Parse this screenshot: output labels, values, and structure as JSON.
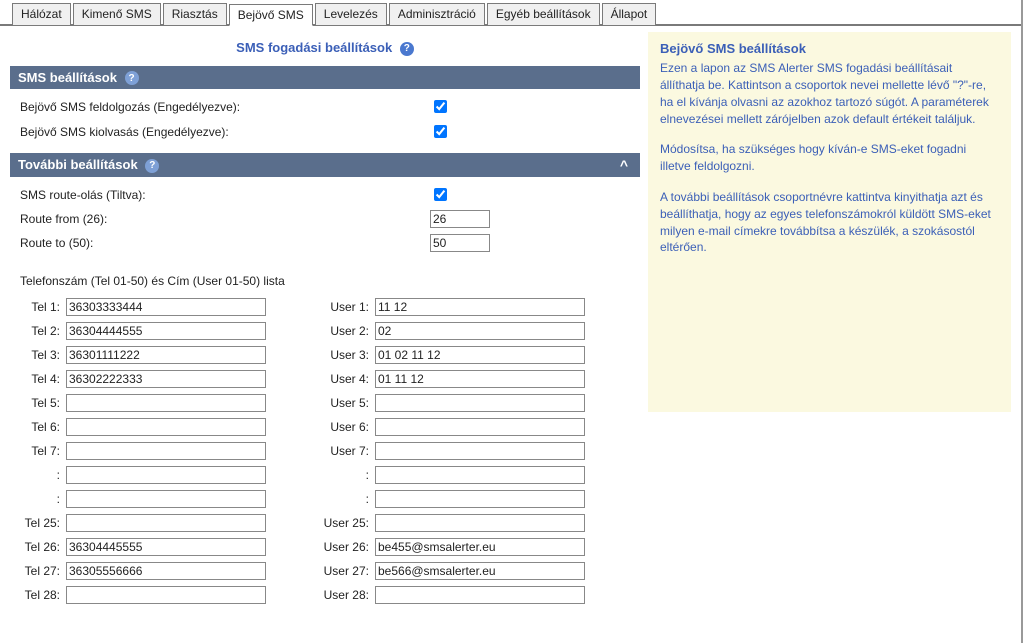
{
  "tabs": [
    {
      "label": "Hálózat"
    },
    {
      "label": "Kimenő SMS"
    },
    {
      "label": "Riasztás"
    },
    {
      "label": "Bejövő SMS",
      "active": true
    },
    {
      "label": "Levelezés"
    },
    {
      "label": "Adminisztráció"
    },
    {
      "label": "Egyéb beállítások"
    },
    {
      "label": "Állapot"
    }
  ],
  "page_title": "SMS fogadási beállítások",
  "section1": {
    "title": "SMS beállítások",
    "row1_label": "Bejövő SMS feldolgozás (Engedélyezve):",
    "row1_checked": true,
    "row2_label": "Bejövő SMS kiolvasás (Engedélyezve):",
    "row2_checked": true
  },
  "section2": {
    "title": "További beállítások",
    "toggle": "^",
    "row1_label": "SMS route-olás (Tiltva):",
    "row1_checked": true,
    "row2_label": "Route from (26):",
    "row2_value": "26",
    "row3_label": "Route to (50):",
    "row3_value": "50"
  },
  "tel_header": "Telefonszám (Tel 01-50) és Cím (User 01-50) lista",
  "rows": [
    {
      "tl": "Tel 1:",
      "tv": "36303333444",
      "ul": "User 1:",
      "uv": "11 12"
    },
    {
      "tl": "Tel 2:",
      "tv": "36304444555",
      "ul": "User 2:",
      "uv": "02"
    },
    {
      "tl": "Tel 3:",
      "tv": "36301111222",
      "ul": "User 3:",
      "uv": "01 02 11 12"
    },
    {
      "tl": "Tel 4:",
      "tv": "36302222333",
      "ul": "User 4:",
      "uv": "01 11 12"
    },
    {
      "tl": "Tel 5:",
      "tv": "",
      "ul": "User 5:",
      "uv": ""
    },
    {
      "tl": "Tel 6:",
      "tv": "",
      "ul": "User 6:",
      "uv": ""
    },
    {
      "tl": "Tel 7:",
      "tv": "",
      "ul": "User 7:",
      "uv": ""
    },
    {
      "tl": ":",
      "tv": "",
      "ul": ":",
      "uv": ""
    },
    {
      "tl": ":",
      "tv": "",
      "ul": ":",
      "uv": ""
    },
    {
      "tl": "Tel 25:",
      "tv": "",
      "ul": "User 25:",
      "uv": ""
    },
    {
      "tl": "Tel 26:",
      "tv": "36304445555",
      "ul": "User 26:",
      "uv": "be455@smsalerter.eu"
    },
    {
      "tl": "Tel 27:",
      "tv": "36305556666",
      "ul": "User 27:",
      "uv": "be566@smsalerter.eu"
    },
    {
      "tl": "Tel 28:",
      "tv": "",
      "ul": "User 28:",
      "uv": ""
    }
  ],
  "info": {
    "title": "Bejövő SMS beállítások",
    "p1": "Ezen a lapon az SMS Alerter SMS fogadási beállításait állíthatja be. Kattintson a csoportok nevei mellette lévő \"?\"-re, ha el kívánja olvasni az azokhoz tartozó súgót. A paraméterek elnevezései mellett zárójelben azok default értékeit találjuk.",
    "p2": "Módosítsa, ha szükséges hogy kíván-e SMS-eket fogadni illetve feldolgozni.",
    "p3": "A további beállítások csoportnévre kattintva kinyithatja azt és beállíthatja, hogy az egyes telefonszámokról küldött SMS-eket milyen e-mail címekre továbbítsa a készülék,  a szokásostól eltérően."
  }
}
